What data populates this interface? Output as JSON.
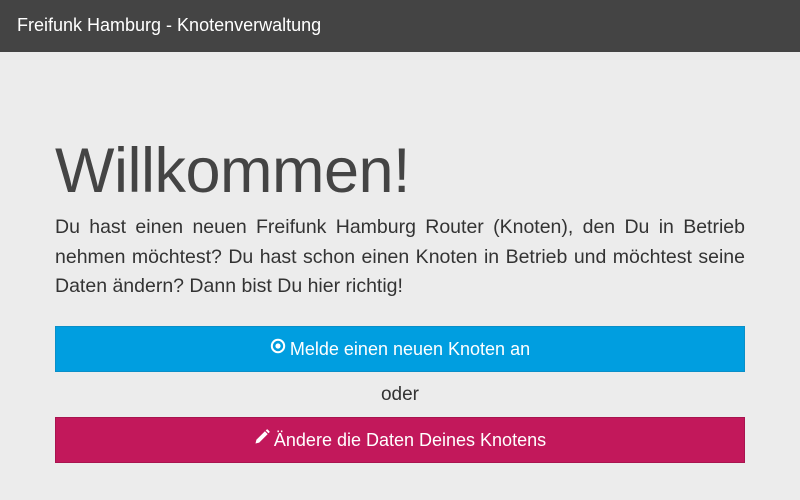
{
  "navbar": {
    "brand": "Freifunk Hamburg - Knotenverwaltung"
  },
  "main": {
    "title": "Willkommen!",
    "intro": "Du hast einen neuen Freifunk Hamburg Router (Knoten), den Du in Betrieb nehmen möchtest? Du hast schon einen Knoten in Betrieb und möchtest seine Daten ändern? Dann bist Du hier richtig!",
    "new_node_button": {
      "label": "Melde einen neuen Knoten an",
      "icon": "dot-circle-icon",
      "color": "#009ee0"
    },
    "or_text": "oder",
    "edit_node_button": {
      "label": "Ändere die Daten Deines Knotens",
      "icon": "pencil-icon",
      "color": "#c2185b"
    }
  },
  "colors": {
    "navbar_bg": "#444444",
    "page_bg": "#ececec",
    "text": "#444444"
  }
}
